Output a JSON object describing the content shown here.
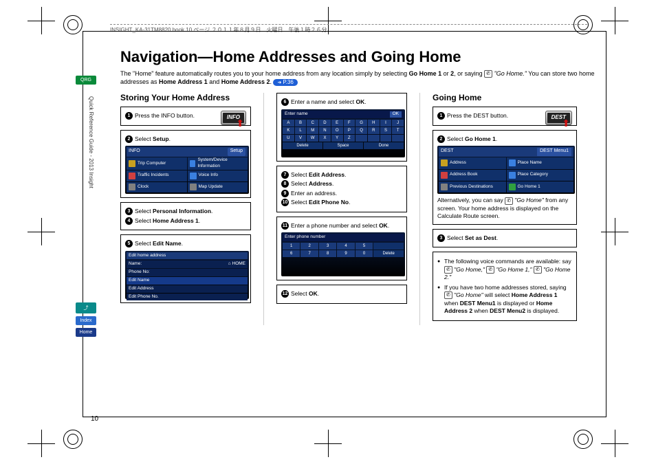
{
  "meta": {
    "header_line": "INSIGHT_KA-31TM8820.book  10 ページ  ２０１１年８月９日　火曜日　午後１時２６分",
    "page_number": "10"
  },
  "sidebar": {
    "tab_qrg": "QRG",
    "side_text": "Quick Reference Guide - 2013 Insight",
    "tab_voice": "⤴",
    "tab_index": "Index",
    "tab_home": "Home"
  },
  "page": {
    "title": "Navigation—Home Addresses and Going Home",
    "intro_1": "The \"Home\" feature automatically routes you to your home address from any location simply by selecting ",
    "intro_bold1": "Go Home 1",
    "intro_or": " or ",
    "intro_bold2": "2",
    "intro_2": ", or saying ",
    "intro_quote": "\"Go Home.\"",
    "intro_3": " You can store two home addresses as ",
    "intro_bold3": "Home Address 1",
    "intro_and": " and ",
    "intro_bold4": "Home Address 2",
    "intro_period": ". ",
    "pill": "P.36"
  },
  "storing": {
    "heading": "Storing Your Home Address",
    "hw_btn_info": "INFO",
    "steps": {
      "s1": "Press the INFO button.",
      "s2a": "Select ",
      "s2b": "Setup",
      "s2c": ".",
      "s3a": "Select ",
      "s3b": "Personal Information",
      "s3c": ".",
      "s4a": "Select ",
      "s4b": "Home Address 1",
      "s4c": ".",
      "s5a": "Select ",
      "s5b": "Edit Name",
      "s5c": ".",
      "s6a": "Enter a name and select ",
      "s6b": "OK",
      "s6c": ".",
      "s7a": "Select ",
      "s7b": "Edit Address",
      "s7c": ".",
      "s8a": "Select ",
      "s8b": "Address",
      "s8c": ".",
      "s9": "Enter an address.",
      "s10a": "Select ",
      "s10b": "Edit Phone No",
      "s10c": ".",
      "s11a": "Enter a phone number and select ",
      "s11b": "OK",
      "s11c": ".",
      "s12a": "Select ",
      "s12b": "OK",
      "s12c": "."
    },
    "info_screen": {
      "title": "INFO",
      "setup": "Setup",
      "cells": [
        "Trip Computer",
        "System/Device Information",
        "Traffic Incidents",
        "Voice Info",
        "Clock",
        "Map Update"
      ]
    },
    "edit_screen": {
      "title": "Edit home address",
      "name": "Name:",
      "home_tag": "⌂ HOME",
      "phone": "Phone No:",
      "rows": [
        "Edit Name",
        "Edit Address",
        "Edit Phone No."
      ]
    },
    "kbd_screen": {
      "title": "Enter name",
      "ok": "OK",
      "bottom": [
        "Delete",
        "Space",
        "Done"
      ]
    },
    "phone_screen": {
      "title": "Enter phone number",
      "right": [
        "",
        "Delete"
      ]
    }
  },
  "going_home": {
    "heading": "Going Home",
    "hw_btn_dest": "DEST",
    "s1": "Press the DEST button.",
    "s2a": "Select ",
    "s2b": "Go Home 1",
    "s2c": ".",
    "dest_screen": {
      "title": "DEST",
      "menu": "DEST Menu1",
      "cells": [
        "Address",
        "Place Name",
        "Address Book",
        "Place Category",
        "Previous Destinations",
        "Go Home 1"
      ]
    },
    "alt1": "Alternatively, you can say ",
    "alt_quote": "\"Go Home\"",
    "alt2": " from any screen. Your home address is displayed on the Calculate Route screen.",
    "s3a": "Select ",
    "s3b": "Set as Dest",
    "s3c": ".",
    "bullet1a": "The following voice commands are available: say ",
    "bullet1_q1": "\"Go Home,\"",
    "bullet1_q2": "\"Go Home 1,\"",
    "bullet1_q3": "\"Go Home 2.\"",
    "bullet2a": "If you have two home addresses stored, saying ",
    "bullet2_q": "\"Go Home\"",
    "bullet2b": " will select ",
    "bullet2_b1": "Home Address 1",
    "bullet2c": " when ",
    "bullet2_b2": "DEST Menu1",
    "bullet2d": " is displayed or ",
    "bullet2_b3": "Home Address 2",
    "bullet2e": " when ",
    "bullet2_b4": "DEST Menu2",
    "bullet2f": " is displayed."
  }
}
